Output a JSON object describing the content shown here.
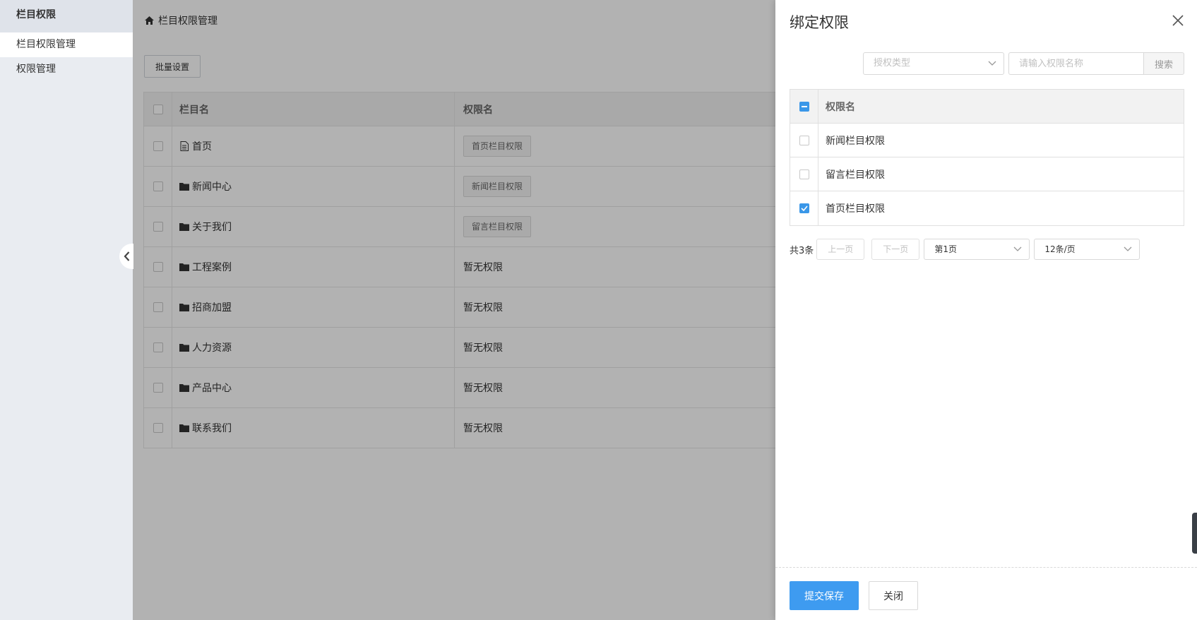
{
  "sidebar": {
    "title": "栏目权限",
    "items": [
      {
        "label": "栏目权限管理",
        "active": true
      },
      {
        "label": "权限管理",
        "active": false
      }
    ]
  },
  "breadcrumb": {
    "icon": "home-icon",
    "label": "栏目权限管理"
  },
  "toolbar": {
    "batch_label": "批量设置"
  },
  "table": {
    "headers": {
      "name": "栏目名",
      "perm": "权限名"
    },
    "rows": [
      {
        "icon": "document-icon",
        "name": "首页",
        "perm": "首页栏目权限",
        "tag": true
      },
      {
        "icon": "folder-icon",
        "name": "新闻中心",
        "perm": "新闻栏目权限",
        "tag": true
      },
      {
        "icon": "folder-icon",
        "name": "关于我们",
        "perm": "留言栏目权限",
        "tag": true
      },
      {
        "icon": "folder-icon",
        "name": "工程案例",
        "perm": "暂无权限",
        "tag": false
      },
      {
        "icon": "folder-icon",
        "name": "招商加盟",
        "perm": "暂无权限",
        "tag": false
      },
      {
        "icon": "folder-icon",
        "name": "人力资源",
        "perm": "暂无权限",
        "tag": false
      },
      {
        "icon": "folder-icon",
        "name": "产品中心",
        "perm": "暂无权限",
        "tag": false
      },
      {
        "icon": "folder-icon",
        "name": "联系我们",
        "perm": "暂无权限",
        "tag": false
      }
    ]
  },
  "drawer": {
    "title": "绑定权限",
    "type_select_placeholder": "授权类型",
    "search_placeholder": "请输入权限名称",
    "search_label": "搜索",
    "table_header": "权限名",
    "rows": [
      {
        "label": "新闻栏目权限",
        "checked": false
      },
      {
        "label": "留言栏目权限",
        "checked": false
      },
      {
        "label": "首页栏目权限",
        "checked": true
      }
    ],
    "pager": {
      "total": "共3条",
      "prev": "上一页",
      "next": "下一页",
      "page": "第1页",
      "page_size": "12条/页"
    },
    "save_label": "提交保存",
    "close_label": "关闭"
  },
  "colors": {
    "primary": "#3e9bf0",
    "overlay": "rgba(0,0,0,0.30)"
  }
}
